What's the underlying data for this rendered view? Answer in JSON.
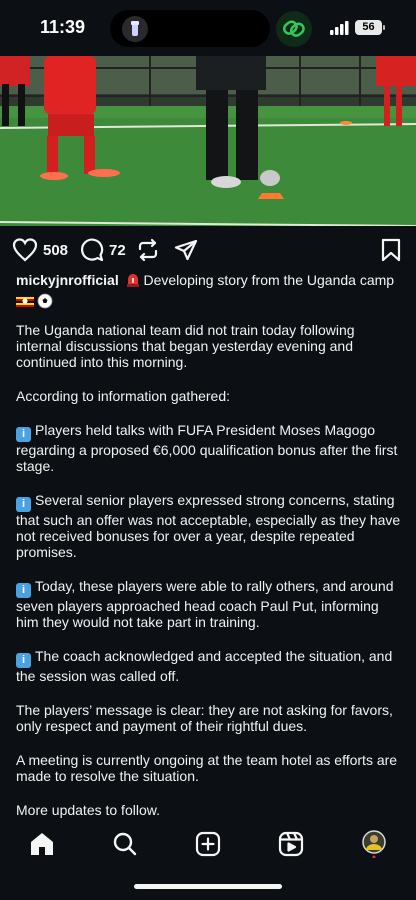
{
  "status": {
    "time": "11:39",
    "battery": "56"
  },
  "post": {
    "likes": "508",
    "comments": "72",
    "username": "mickyjnrofficial",
    "headline": " Developing story from the Uganda camp",
    "paragraphs": [
      "The Uganda national team did not train today following internal discussions that began yesterday evening and continued into this morning.",
      "According to information gathered:",
      "Players held talks with FUFA President Moses Magogo regarding a proposed €6,000 qualification bonus after the first stage.",
      "Several senior players expressed strong concerns, stating that such an offer was not acceptable, especially as they have not received bonuses for over a year, despite repeated promises.",
      "Today, these players were able to rally others, and around seven players approached head coach Paul Put, informing him they would not take part in training.",
      "The coach acknowledged and accepted the situation, and the session was called off.",
      "The players’ message is clear: they are not asking for favors, only respect and payment of their rightful dues.",
      "A meeting is currently ongoing at the team hotel as efforts are made to resolve the situation.",
      "More updates to follow."
    ],
    "info_glyph": "i"
  },
  "icons": {
    "like": "heart-icon",
    "comment": "comment-icon",
    "repost": "repost-icon",
    "share": "share-icon",
    "save": "bookmark-icon"
  },
  "colors": {
    "background": "#0c1014",
    "text": "#f5f5f5",
    "info_badge": "#4aa3df",
    "alert": "#e0322e"
  }
}
